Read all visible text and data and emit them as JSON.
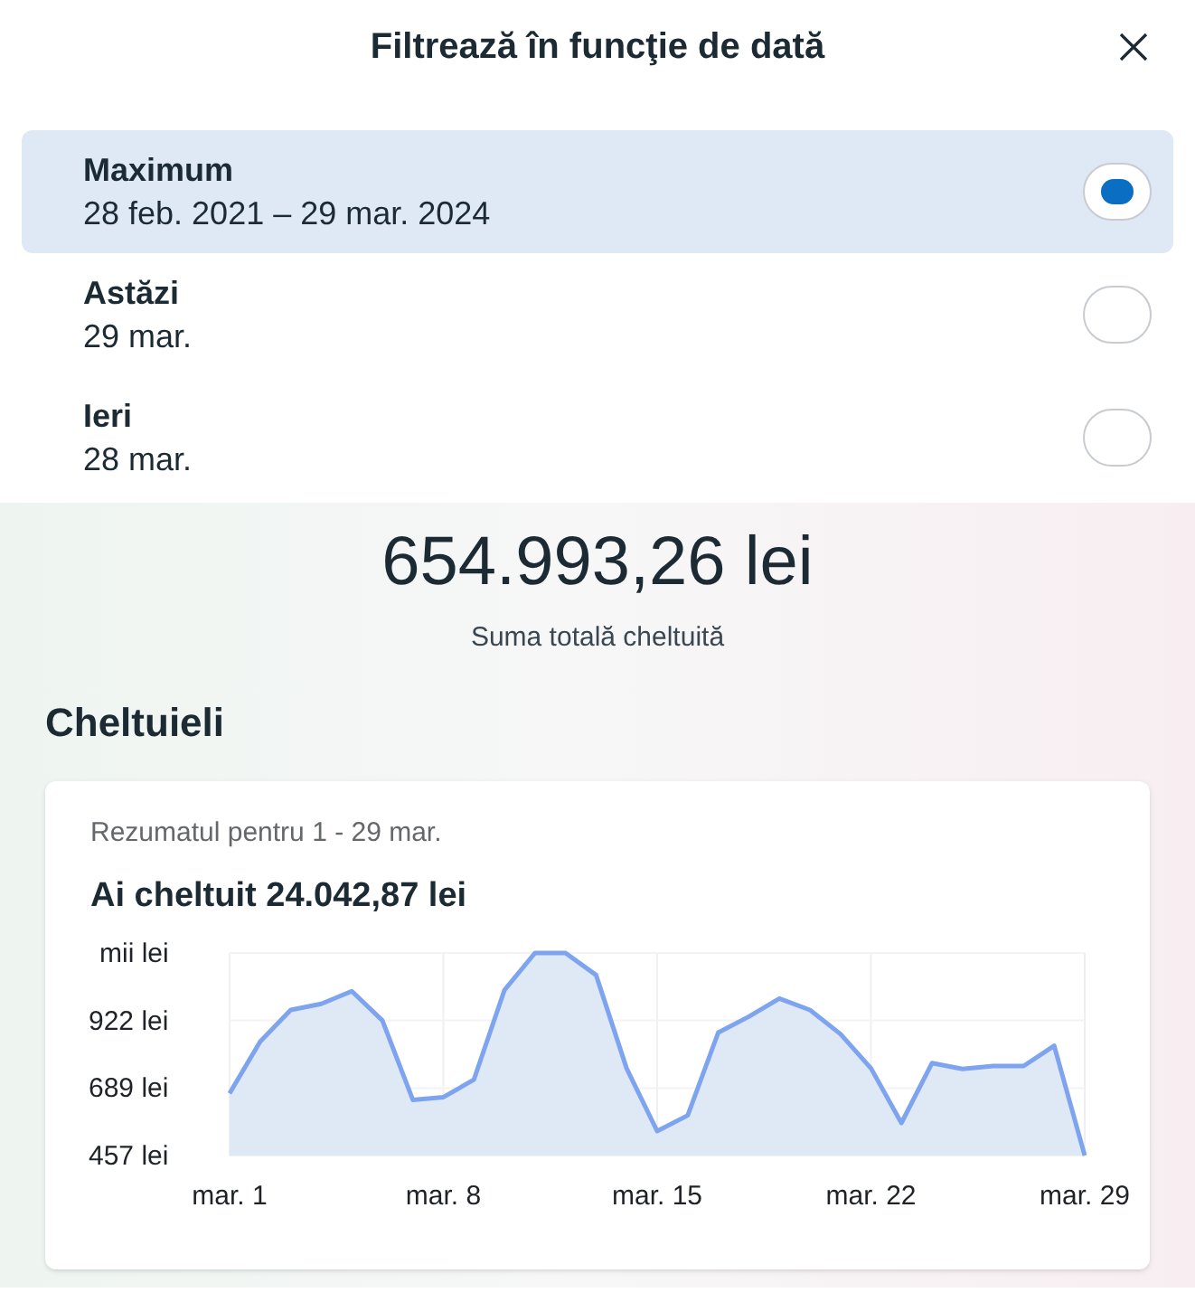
{
  "header": {
    "title": "Filtrează în funcţie de dată"
  },
  "options": [
    {
      "label": "Maximum",
      "range": "28 feb. 2021 – 29 mar. 2024",
      "selected": true
    },
    {
      "label": "Astăzi",
      "range": "29 mar.",
      "selected": false
    },
    {
      "label": "Ieri",
      "range": "28 mar.",
      "selected": false
    }
  ],
  "total": {
    "amount": "654.993,26 lei",
    "caption": "Suma totală cheltuită"
  },
  "section_title": "Cheltuieli",
  "summary": {
    "period": "Rezumatul pentru 1 - 29 mar.",
    "spent_prefix": "Ai cheltuit",
    "spent_amount": "24.042,87 lei",
    "chart_data": {
      "type": "area",
      "grid": true,
      "categories": [
        "mar. 1",
        null,
        null,
        null,
        null,
        null,
        null,
        "mar. 8",
        null,
        null,
        null,
        null,
        null,
        null,
        "mar. 15",
        null,
        null,
        null,
        null,
        null,
        null,
        "mar. 22",
        null,
        null,
        null,
        null,
        null,
        null,
        "mar. 29"
      ],
      "series": [
        {
          "color": "#7ea4ef",
          "values": [
            671,
            849,
            958,
            979,
            1023,
            922,
            648,
            658,
            718,
            1026,
            1154,
            1154,
            1078,
            757,
            541,
            595,
            880,
            935,
            997,
            958,
            875,
            757,
            569,
            775,
            755,
            765,
            765,
            835,
            457
          ]
        }
      ],
      "ylim": [
        457,
        1154
      ],
      "yticks": [
        {
          "value": 457,
          "label": "457 lei"
        },
        {
          "value": 689,
          "label": "689 lei"
        },
        {
          "value": 922,
          "label": "922 lei"
        },
        {
          "value": 1154,
          "label": "mii lei"
        }
      ]
    }
  }
}
